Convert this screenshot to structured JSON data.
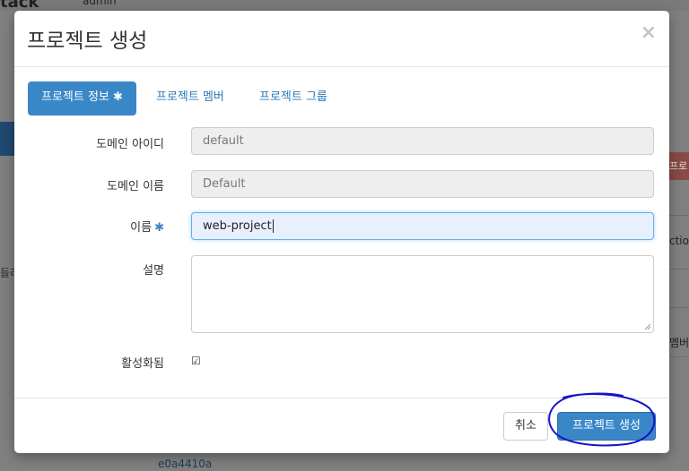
{
  "background": {
    "logo_text": "tack",
    "user_text": "admin",
    "left_text": "들리",
    "red_button_text": "프로",
    "right_text_1": "ction",
    "right_text_2": "멤버",
    "row_id": "e0a4410a"
  },
  "modal": {
    "title": "프로젝트 생성",
    "close_symbol": "×",
    "tabs": [
      {
        "label": "프로젝트 정보",
        "required_marker": "✱",
        "active": true
      },
      {
        "label": "프로젝트 멤버",
        "active": false
      },
      {
        "label": "프로젝트 그룹",
        "active": false
      }
    ],
    "fields": {
      "domain_id": {
        "label": "도메인 아이디",
        "value": "default",
        "disabled": true
      },
      "domain_name": {
        "label": "도메인 이름",
        "value": "Default",
        "disabled": true
      },
      "name": {
        "label": "이름",
        "required_marker": "✱",
        "value": "web-project"
      },
      "description": {
        "label": "설명",
        "value": ""
      },
      "enabled": {
        "label": "활성화됨",
        "checked": true,
        "check_symbol": "☑"
      }
    },
    "footer": {
      "cancel_label": "취소",
      "create_label": "프로젝트 생성"
    }
  },
  "colors": {
    "primary": "#3a87c8",
    "annotation": "#1414c8",
    "overlay": "#808080"
  }
}
